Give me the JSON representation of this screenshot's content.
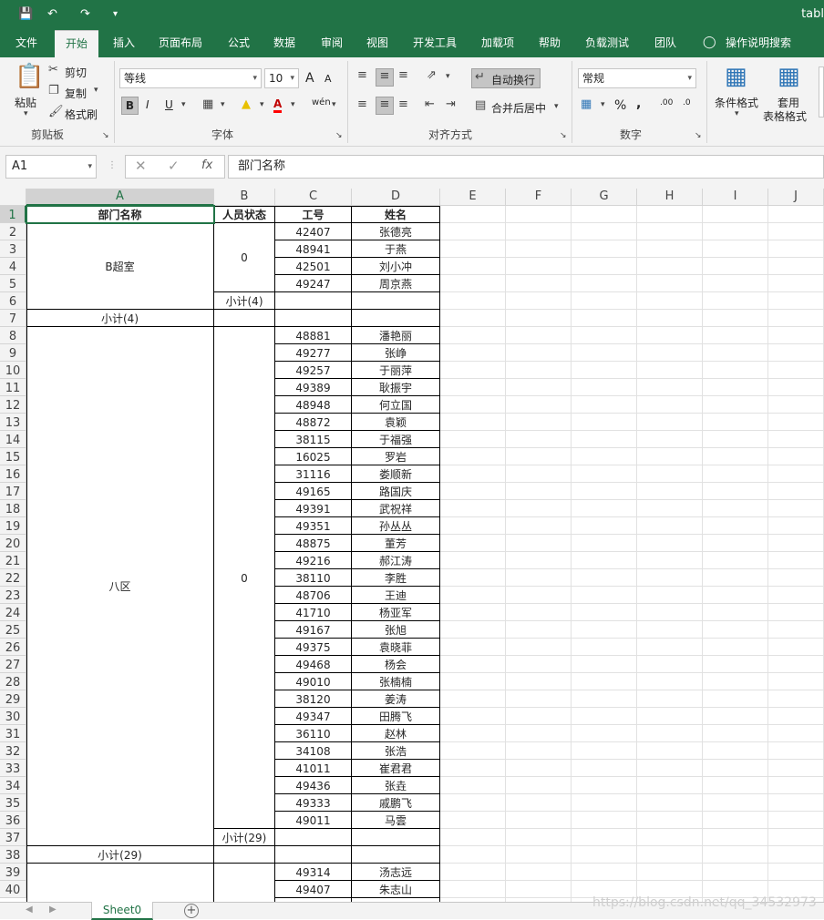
{
  "title_bar": {
    "doc_name": "tabl"
  },
  "ribbon_tabs": [
    "文件",
    "开始",
    "插入",
    "页面布局",
    "公式",
    "数据",
    "审阅",
    "视图",
    "开发工具",
    "加载项",
    "帮助",
    "负载测试",
    "团队",
    "操作说明搜索"
  ],
  "clipboard": {
    "paste": "粘贴",
    "cut": "剪切",
    "copy": "复制",
    "format_painter": "格式刷",
    "group": "剪贴板"
  },
  "font": {
    "name": "等线",
    "size": "10",
    "bold": "B",
    "italic": "I",
    "underline": "U",
    "group": "字体",
    "grow": "A",
    "shrink": "A",
    "font_color": "A",
    "phonetic": "wén"
  },
  "alignment": {
    "wrap": "自动换行",
    "merge": "合并后居中",
    "group": "对齐方式"
  },
  "number": {
    "format": "常规",
    "percent": "%",
    "comma": ",",
    "inc_dec": ".00",
    "dec_dec": ".0",
    "group": "数字"
  },
  "styles": {
    "conditional": "条件格式",
    "table_fmt_1": "套用",
    "table_fmt_2": "表格格式"
  },
  "formula_bar": {
    "name_box": "A1",
    "fx": "fx",
    "content": "部门名称"
  },
  "columns": [
    "A",
    "B",
    "C",
    "D",
    "E",
    "F",
    "G",
    "H",
    "I",
    "J"
  ],
  "rows": [
    "1",
    "2",
    "3",
    "4",
    "5",
    "6",
    "7",
    "8",
    "9",
    "10",
    "11",
    "12",
    "13",
    "14",
    "15",
    "16",
    "17",
    "18",
    "19",
    "20",
    "21",
    "22",
    "23",
    "24",
    "25",
    "26",
    "27",
    "28",
    "29",
    "30",
    "31",
    "32",
    "33",
    "34",
    "35",
    "36",
    "37",
    "38",
    "39",
    "40"
  ],
  "table": {
    "headers": [
      "部门名称",
      "人员状态",
      "工号",
      "姓名"
    ],
    "group1": {
      "dept": "B超室",
      "status": "0",
      "subtotal_status": "小计(4)",
      "subtotal_dept": "小计(4)"
    },
    "group2": {
      "dept": "八区",
      "status": "0",
      "subtotal_status": "小计(29)",
      "subtotal_dept": "小计(29)"
    },
    "employees": [
      [
        "42407",
        "张德亮"
      ],
      [
        "48941",
        "于燕"
      ],
      [
        "42501",
        "刘小冲"
      ],
      [
        "49247",
        "周京燕"
      ],
      [
        "48881",
        "潘艳丽"
      ],
      [
        "49277",
        "张峥"
      ],
      [
        "49257",
        "于丽萍"
      ],
      [
        "49389",
        "耿振宇"
      ],
      [
        "48948",
        "何立国"
      ],
      [
        "48872",
        "袁颖"
      ],
      [
        "38115",
        "于福强"
      ],
      [
        "16025",
        "罗岩"
      ],
      [
        "31116",
        "娄顺新"
      ],
      [
        "49165",
        "路国庆"
      ],
      [
        "49391",
        "武祝祥"
      ],
      [
        "49351",
        "孙丛丛"
      ],
      [
        "48875",
        "董芳"
      ],
      [
        "49216",
        "郝江涛"
      ],
      [
        "38110",
        "李胜"
      ],
      [
        "48706",
        "王迪"
      ],
      [
        "41710",
        "杨亚军"
      ],
      [
        "49167",
        "张旭"
      ],
      [
        "49375",
        "袁晓菲"
      ],
      [
        "49468",
        "杨会"
      ],
      [
        "49010",
        "张楠楠"
      ],
      [
        "38120",
        "姜涛"
      ],
      [
        "49347",
        "田腾飞"
      ],
      [
        "36110",
        "赵林"
      ],
      [
        "34108",
        "张浩"
      ],
      [
        "41011",
        "崔君君"
      ],
      [
        "49436",
        "张垚"
      ],
      [
        "49333",
        "戚鹏飞"
      ],
      [
        "49011",
        "马雲"
      ],
      [
        "49314",
        "汤志远"
      ],
      [
        "49407",
        "朱志山"
      ]
    ]
  },
  "sheet_tab": "Sheet0",
  "add_sheet": "+",
  "watermark": "https://blog.csdn.net/qq_34532973",
  "colors": {
    "accent": "#217346"
  }
}
